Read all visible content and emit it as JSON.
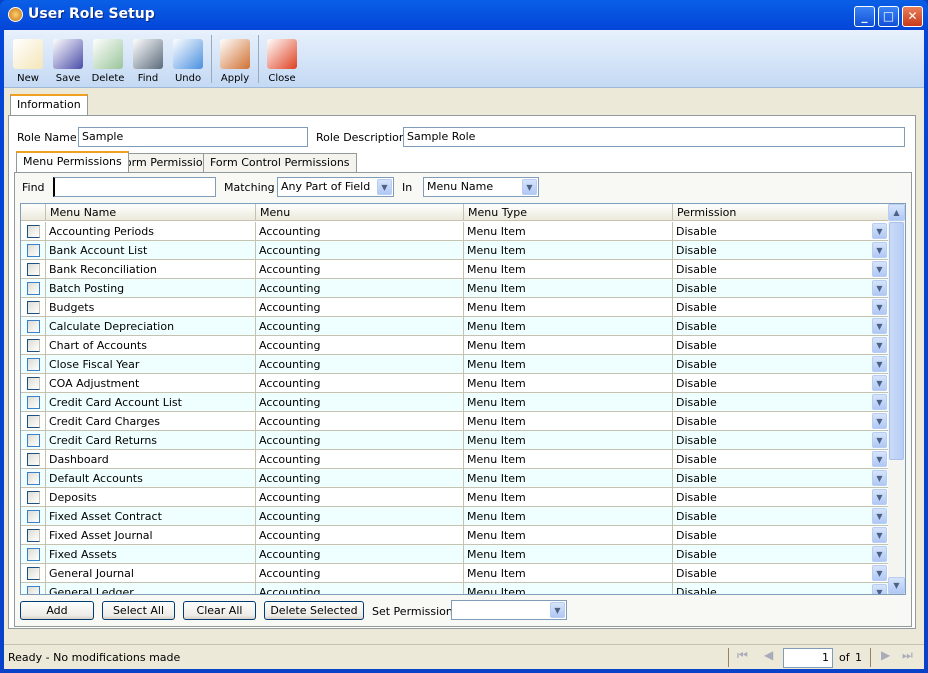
{
  "window": {
    "title": "User Role Setup",
    "min": "_",
    "max": "□",
    "close": "✕"
  },
  "toolbar": [
    {
      "label": "New",
      "icon": "new-document-icon",
      "color": "#f4e6b8"
    },
    {
      "label": "Save",
      "icon": "floppy-disk-icon",
      "color": "#4a4ca8"
    },
    {
      "label": "Delete",
      "icon": "recycle-bin-icon",
      "color": "#9ac49a"
    },
    {
      "label": "Find",
      "icon": "binoculars-icon",
      "color": "#5a6a7a"
    },
    {
      "label": "Undo",
      "icon": "undo-arrow-icon",
      "color": "#4a90e0"
    },
    {
      "label": "Apply",
      "icon": "users-icon",
      "color": "#d07030"
    },
    {
      "label": "Close",
      "icon": "close-form-icon",
      "color": "#e04020"
    }
  ],
  "tabs": {
    "information": "Information",
    "menu": "Menu Permissions",
    "form": "Form Permissions",
    "control": "Form Control Permissions"
  },
  "form": {
    "role_name_label": "Role Name",
    "role_name": "Sample",
    "role_desc_label": "Role Description",
    "role_desc": "Sample Role"
  },
  "filter": {
    "find_label": "Find",
    "find_value": "",
    "matching_label": "Matching",
    "matching": "Any Part of Field",
    "in_label": "In",
    "in": "Menu Name"
  },
  "grid": {
    "columns": [
      "Menu Name",
      "Menu",
      "Menu Type",
      "Permission"
    ],
    "rows": [
      [
        "Accounting Periods",
        "Accounting",
        "Menu Item",
        "Disable"
      ],
      [
        "Bank Account List",
        "Accounting",
        "Menu Item",
        "Disable"
      ],
      [
        "Bank Reconciliation",
        "Accounting",
        "Menu Item",
        "Disable"
      ],
      [
        "Batch Posting",
        "Accounting",
        "Menu Item",
        "Disable"
      ],
      [
        "Budgets",
        "Accounting",
        "Menu Item",
        "Disable"
      ],
      [
        "Calculate Depreciation",
        "Accounting",
        "Menu Item",
        "Disable"
      ],
      [
        "Chart of Accounts",
        "Accounting",
        "Menu Item",
        "Disable"
      ],
      [
        "Close Fiscal Year",
        "Accounting",
        "Menu Item",
        "Disable"
      ],
      [
        "COA Adjustment",
        "Accounting",
        "Menu Item",
        "Disable"
      ],
      [
        "Credit Card Account List",
        "Accounting",
        "Menu Item",
        "Disable"
      ],
      [
        "Credit Card Charges",
        "Accounting",
        "Menu Item",
        "Disable"
      ],
      [
        "Credit Card Returns",
        "Accounting",
        "Menu Item",
        "Disable"
      ],
      [
        "Dashboard",
        "Accounting",
        "Menu Item",
        "Disable"
      ],
      [
        "Default Accounts",
        "Accounting",
        "Menu Item",
        "Disable"
      ],
      [
        "Deposits",
        "Accounting",
        "Menu Item",
        "Disable"
      ],
      [
        "Fixed Asset Contract",
        "Accounting",
        "Menu Item",
        "Disable"
      ],
      [
        "Fixed Asset Journal",
        "Accounting",
        "Menu Item",
        "Disable"
      ],
      [
        "Fixed Assets",
        "Accounting",
        "Menu Item",
        "Disable"
      ],
      [
        "General Journal",
        "Accounting",
        "Menu Item",
        "Disable"
      ],
      [
        "General Ledger",
        "Accounting",
        "Menu Item",
        "Disable"
      ]
    ]
  },
  "buttons": {
    "add": "Add",
    "select_all": "Select All",
    "clear_all": "Clear All",
    "delete_selected": "Delete Selected",
    "set_permission_label": "Set Permission",
    "set_permission": ""
  },
  "status": {
    "text": "Ready - No modifications made",
    "page": "1",
    "of": "of",
    "total": "1"
  }
}
